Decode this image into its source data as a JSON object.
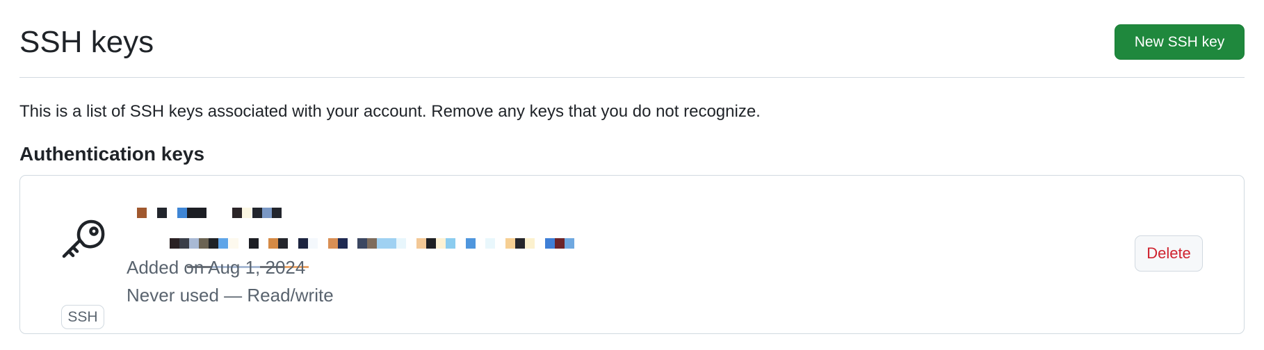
{
  "header": {
    "title": "SSH keys",
    "new_key_button": "New SSH key"
  },
  "description": "This is a list of SSH keys associated with your account. Remove any keys that you do not recognize.",
  "section": {
    "title": "Authentication keys"
  },
  "keys": [
    {
      "icon": "key-icon",
      "type_badge": "SSH",
      "added": "Added on Aug 1, 2024",
      "usage": "Never used — Read/write",
      "delete_label": "Delete",
      "title_redacted": true,
      "fingerprint_redacted": true
    }
  ],
  "colors": {
    "primary_button": "#1f883d",
    "danger_text": "#cf222e",
    "border": "#d1d9e0",
    "muted_text": "#59636e",
    "text": "#1f2328"
  }
}
